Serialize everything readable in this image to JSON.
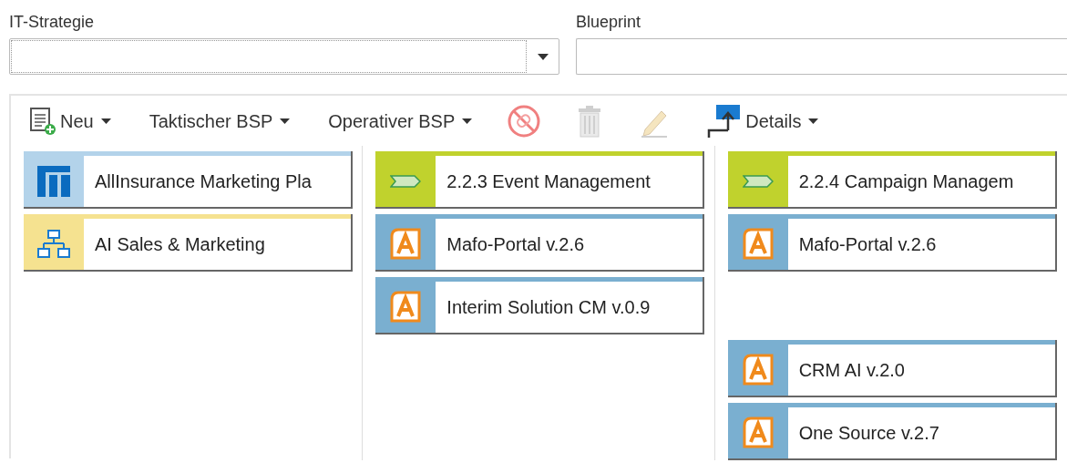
{
  "filters": [
    {
      "label": "IT-Strategie",
      "kind": "select"
    },
    {
      "label": "Blueprint",
      "kind": "text"
    }
  ],
  "toolbar": [
    {
      "kind": "new",
      "label": "Neu",
      "menu": true,
      "disabled": false
    },
    {
      "kind": "text",
      "label": "Taktischer BSP",
      "menu": true,
      "disabled": false
    },
    {
      "kind": "text",
      "label": "Operativer BSP",
      "menu": true,
      "disabled": false
    },
    {
      "kind": "unlink",
      "disabled": false
    },
    {
      "kind": "delete",
      "disabled": true
    },
    {
      "kind": "edit",
      "disabled": true
    },
    {
      "kind": "details",
      "label": "Details",
      "menu": true,
      "disabled": false
    }
  ],
  "columns": [
    {
      "cards": [
        {
          "kind": "plan",
          "label": "AllInsurance Marketing Pla"
        },
        {
          "kind": "domain",
          "label": "AI Sales & Marketing"
        }
      ]
    },
    {
      "cards": [
        {
          "kind": "process",
          "label": "2.2.3 Event Management"
        },
        {
          "kind": "application",
          "label": "Mafo-Portal v.2.6"
        },
        {
          "kind": "application",
          "label": "Interim Solution CM v.0.9"
        }
      ]
    },
    {
      "cards": [
        {
          "kind": "process",
          "label": "2.2.4 Campaign Managem"
        },
        {
          "kind": "application",
          "label": "Mafo-Portal v.2.6"
        },
        {
          "kind": "empty"
        },
        {
          "kind": "application",
          "label": "CRM AI v.2.0"
        },
        {
          "kind": "application",
          "label": "One Source v.2.7"
        }
      ]
    }
  ]
}
